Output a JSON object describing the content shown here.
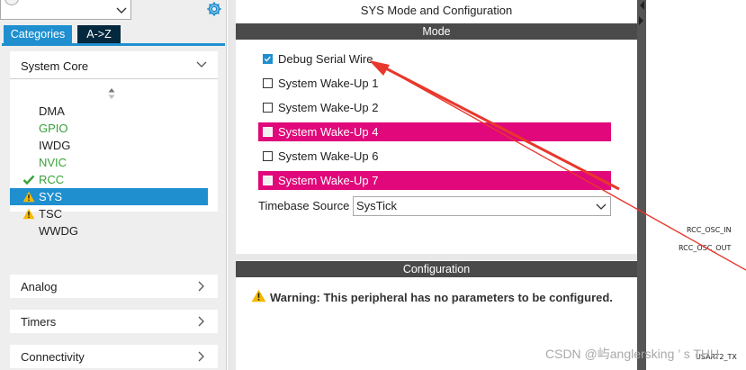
{
  "sidebar": {
    "search_value": "",
    "tabs": [
      {
        "label": "Categories",
        "active": true
      },
      {
        "label": "A->Z",
        "active": false
      }
    ],
    "system_core": {
      "label": "System Core",
      "items": [
        {
          "label": "DMA",
          "status": "none"
        },
        {
          "label": "GPIO",
          "status": "configured-green"
        },
        {
          "label": "IWDG",
          "status": "none"
        },
        {
          "label": "NVIC",
          "status": "configured-green"
        },
        {
          "label": "RCC",
          "status": "check"
        },
        {
          "label": "SYS",
          "status": "warning",
          "selected": true
        },
        {
          "label": "TSC",
          "status": "warning"
        },
        {
          "label": "WWDG",
          "status": "none"
        }
      ]
    },
    "categories": [
      {
        "label": "Analog"
      },
      {
        "label": "Timers"
      },
      {
        "label": "Connectivity"
      }
    ]
  },
  "panel": {
    "title": "SYS Mode and Configuration",
    "mode_header": "Mode",
    "options": [
      {
        "label": "Debug Serial Wire",
        "checked": true,
        "highlighted": false
      },
      {
        "label": "System Wake-Up 1",
        "checked": false,
        "highlighted": false
      },
      {
        "label": "System Wake-Up 2",
        "checked": false,
        "highlighted": false
      },
      {
        "label": "System Wake-Up 4",
        "checked": false,
        "highlighted": true
      },
      {
        "label": "System Wake-Up 6",
        "checked": false,
        "highlighted": false
      },
      {
        "label": "System Wake-Up 7",
        "checked": false,
        "highlighted": true
      }
    ],
    "timebase": {
      "label": "Timebase Source",
      "value": "SysTick"
    },
    "config_header": "Configuration",
    "warning": "Warning: This peripheral has no parameters to be configured."
  },
  "pinout": {
    "pin_in": "RCC_OSC_IN",
    "pin_out": "RCC_OSC_OUT",
    "pin_tx": "USART2_TX"
  },
  "watermark": "CSDN @屿anglersking ’ s THU",
  "colors": {
    "accent": "#1f8fd0",
    "highlight": "#e0087a",
    "header": "#4a4a4a",
    "success": "#39a139",
    "warning": "#f5b800",
    "annotation": "#e8372c"
  }
}
